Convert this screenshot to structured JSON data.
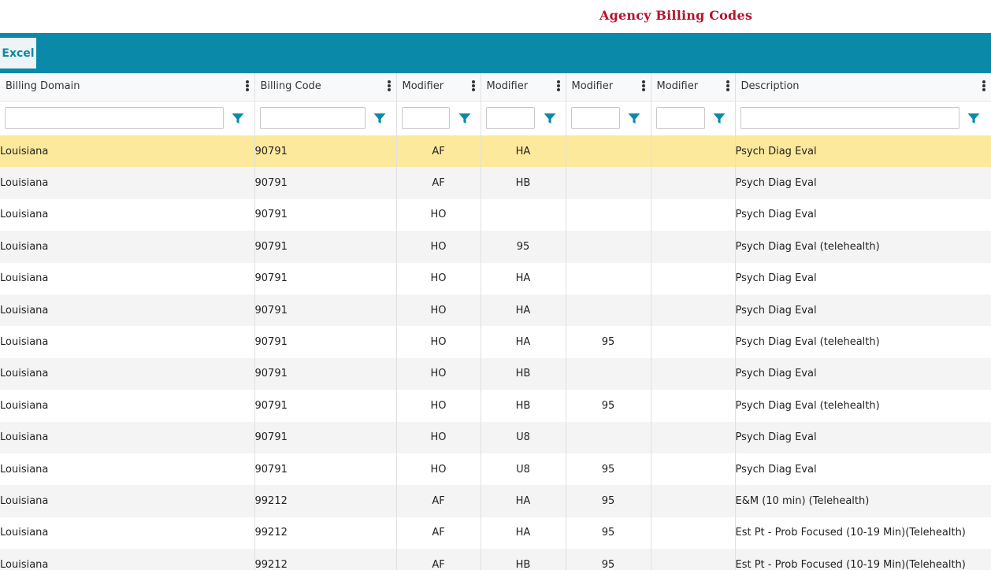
{
  "header": {
    "title": "Agency Billing Codes"
  },
  "toolbar": {
    "excel_label": "Excel"
  },
  "columns": {
    "billing_domain": "Billing Domain",
    "billing_code": "Billing Code",
    "modifier1": "Modifier",
    "modifier2": "Modifier",
    "modifier3": "Modifier",
    "modifier4": "Modifier",
    "description": "Description"
  },
  "icons": {
    "column_menu": "kebab-menu-icon",
    "filter": "filter-icon"
  },
  "colors": {
    "accent": "#0a8aa8",
    "title": "#b5122e",
    "selected_row": "#fde99c"
  },
  "rows": [
    {
      "domain": "Louisiana",
      "code": "90791",
      "mod1": "AF",
      "mod2": "HA",
      "mod3": "",
      "mod4": "",
      "description": "Psych Diag Eval"
    },
    {
      "domain": "Louisiana",
      "code": "90791",
      "mod1": "AF",
      "mod2": "HB",
      "mod3": "",
      "mod4": "",
      "description": "Psych Diag Eval"
    },
    {
      "domain": "Louisiana",
      "code": "90791",
      "mod1": "HO",
      "mod2": "",
      "mod3": "",
      "mod4": "",
      "description": "Psych Diag Eval"
    },
    {
      "domain": "Louisiana",
      "code": "90791",
      "mod1": "HO",
      "mod2": "95",
      "mod3": "",
      "mod4": "",
      "description": "Psych Diag Eval (telehealth)"
    },
    {
      "domain": "Louisiana",
      "code": "90791",
      "mod1": "HO",
      "mod2": "HA",
      "mod3": "",
      "mod4": "",
      "description": "Psych Diag Eval"
    },
    {
      "domain": "Louisiana",
      "code": "90791",
      "mod1": "HO",
      "mod2": "HA",
      "mod3": "",
      "mod4": "",
      "description": "Psych Diag Eval"
    },
    {
      "domain": "Louisiana",
      "code": "90791",
      "mod1": "HO",
      "mod2": "HA",
      "mod3": "95",
      "mod4": "",
      "description": "Psych Diag Eval (telehealth)"
    },
    {
      "domain": "Louisiana",
      "code": "90791",
      "mod1": "HO",
      "mod2": "HB",
      "mod3": "",
      "mod4": "",
      "description": "Psych Diag Eval"
    },
    {
      "domain": "Louisiana",
      "code": "90791",
      "mod1": "HO",
      "mod2": "HB",
      "mod3": "95",
      "mod4": "",
      "description": "Psych Diag Eval (telehealth)"
    },
    {
      "domain": "Louisiana",
      "code": "90791",
      "mod1": "HO",
      "mod2": "U8",
      "mod3": "",
      "mod4": "",
      "description": "Psych Diag Eval"
    },
    {
      "domain": "Louisiana",
      "code": "90791",
      "mod1": "HO",
      "mod2": "U8",
      "mod3": "95",
      "mod4": "",
      "description": "Psych Diag Eval"
    },
    {
      "domain": "Louisiana",
      "code": "99212",
      "mod1": "AF",
      "mod2": "HA",
      "mod3": "95",
      "mod4": "",
      "description": "E&M (10 min) (Telehealth)"
    },
    {
      "domain": "Louisiana",
      "code": "99212",
      "mod1": "AF",
      "mod2": "HA",
      "mod3": "95",
      "mod4": "",
      "description": "Est Pt - Prob Focused (10-19 Min)(Telehealth)"
    },
    {
      "domain": "Louisiana",
      "code": "99212",
      "mod1": "AF",
      "mod2": "HB",
      "mod3": "95",
      "mod4": "",
      "description": "Est Pt - Prob Focused (10-19 Min)(Telehealth)"
    }
  ]
}
